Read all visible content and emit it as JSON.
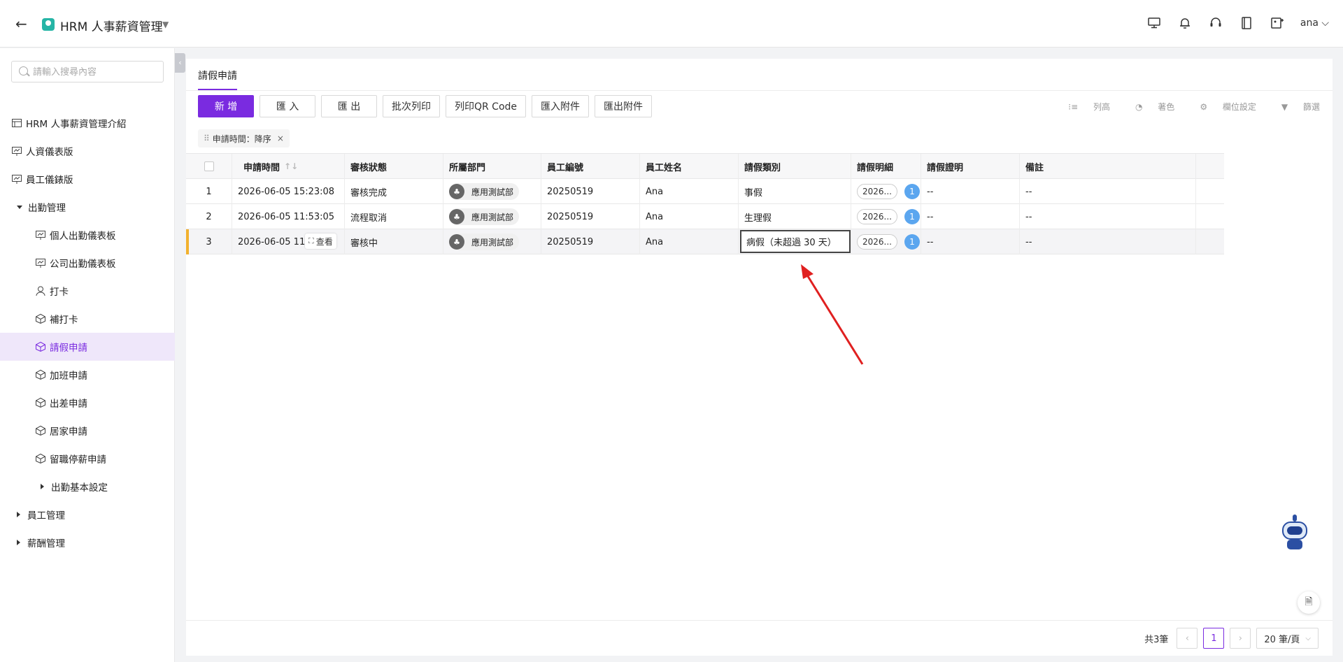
{
  "header": {
    "app_title": "HRM 人事薪資管理",
    "user": "ana",
    "icons": [
      "monitor-icon",
      "bell-icon",
      "headset-icon",
      "book-icon",
      "image-add-icon"
    ]
  },
  "sidebar": {
    "search_placeholder": "請輸入搜尋內容",
    "items": [
      {
        "label": "HRM 人事薪資管理介紹",
        "icon": "table-icon"
      },
      {
        "label": "人資儀表版",
        "icon": "dashboard-icon"
      },
      {
        "label": "員工儀錶版",
        "icon": "dashboard-icon"
      },
      {
        "label": "出勤管理",
        "icon": "caret-down"
      },
      {
        "label": "個人出勤儀表板",
        "icon": "dashboard-icon"
      },
      {
        "label": "公司出勤儀表板",
        "icon": "dashboard-icon"
      },
      {
        "label": "打卡",
        "icon": "user-icon"
      },
      {
        "label": "補打卡",
        "icon": "cube-icon"
      },
      {
        "label": "請假申請",
        "icon": "cube-icon"
      },
      {
        "label": "加班申請",
        "icon": "cube-icon"
      },
      {
        "label": "出差申請",
        "icon": "cube-icon"
      },
      {
        "label": "居家申請",
        "icon": "cube-icon"
      },
      {
        "label": "留職停薪申請",
        "icon": "cube-icon"
      },
      {
        "label": "出勤基本設定",
        "icon": "caret-right"
      },
      {
        "label": "員工管理",
        "icon": "caret-right"
      },
      {
        "label": "薪酬管理",
        "icon": "caret-right"
      }
    ]
  },
  "main": {
    "tab": "請假申請",
    "toolbar": [
      "新 增",
      "匯 入",
      "匯 出",
      "批次列印",
      "列印QR Code",
      "匯入附件",
      "匯出附件"
    ],
    "right_tools": [
      "列高",
      "著色",
      "欄位設定",
      "篩選"
    ],
    "sort_tag": "申請時間：降序",
    "columns": [
      "申請時間",
      "審核狀態",
      "所屬部門",
      "員工編號",
      "員工姓名",
      "請假類別",
      "請假明細",
      "請假證明",
      "備註"
    ],
    "rows": [
      {
        "no": "1",
        "time": "2026-06-05 15:23:08",
        "status": "審核完成",
        "dept": "應用測試部",
        "emp_id": "20250519",
        "name": "Ana",
        "type": "事假",
        "detail": "2026...",
        "count": "1",
        "proof": "--",
        "note": "--"
      },
      {
        "no": "2",
        "time": "2026-06-05 11:53:05",
        "status": "流程取消",
        "dept": "應用測試部",
        "emp_id": "20250519",
        "name": "Ana",
        "type": "生理假",
        "detail": "2026...",
        "count": "1",
        "proof": "--",
        "note": "--"
      },
      {
        "no": "3",
        "time": "2026-06-05 11:5",
        "status": "審核中",
        "dept": "應用測試部",
        "emp_id": "20250519",
        "name": "Ana",
        "type": "病假（未超過 30 天）",
        "detail": "2026...",
        "count": "1",
        "proof": "--",
        "note": "--"
      }
    ],
    "view_label": "查看"
  },
  "pager": {
    "total": "共3筆",
    "current_page": "1",
    "page_size": "20 筆/頁"
  },
  "colors": {
    "accent": "#7a2be0",
    "arrow": "#e02020",
    "count_badge": "#5ba6ef"
  }
}
